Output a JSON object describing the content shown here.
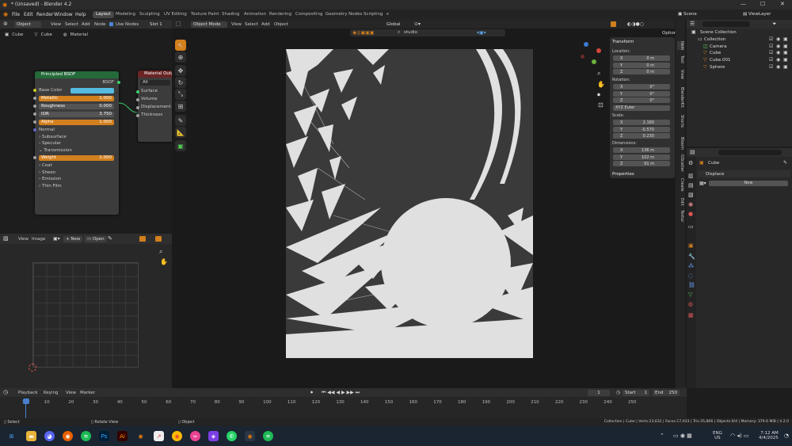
{
  "window": {
    "title": "* (Unsaved) - Blender 4.2"
  },
  "menus": [
    "File",
    "Edit",
    "Render",
    "Window",
    "Help"
  ],
  "workspaces": [
    "Layout",
    "Modeling",
    "Sculpting",
    "UV Editing",
    "Texture Paint",
    "Shading",
    "Animation",
    "Rendering",
    "Compositing",
    "Geometry Nodes",
    "Scripting",
    "+"
  ],
  "scene": {
    "label": "Scene",
    "view_layer": "ViewLayer"
  },
  "node_editor": {
    "object_mode": "Object",
    "menus": [
      "View",
      "Select",
      "Add",
      "Node"
    ],
    "use_nodes": "Use Nodes",
    "slot": "Slot 1",
    "breadcrumb": [
      "Cube",
      "Cube",
      "Material"
    ]
  },
  "bsdf": {
    "title": "Principled BSDF",
    "output": "BSDF",
    "rows": [
      {
        "label": "Base Color",
        "type": "color"
      },
      {
        "label": "Metallic",
        "value": "1.000",
        "type": "orange"
      },
      {
        "label": "Roughness",
        "value": "0.000",
        "type": "gray"
      },
      {
        "label": "IOR",
        "value": "3.750",
        "type": "gray"
      },
      {
        "label": "Alpha",
        "value": "1.000",
        "type": "orange"
      },
      {
        "label": "Normal",
        "type": "plain"
      },
      {
        "label": "Subsurface",
        "type": "sub"
      },
      {
        "label": "Specular",
        "type": "sub"
      },
      {
        "label": "Transmission",
        "type": "open"
      },
      {
        "label": "Weight",
        "value": "1.000",
        "type": "orange"
      },
      {
        "label": "Coat",
        "type": "sub"
      },
      {
        "label": "Sheen",
        "type": "sub"
      },
      {
        "label": "Emission",
        "type": "sub"
      },
      {
        "label": "Thin Film",
        "type": "sub"
      }
    ]
  },
  "mat_output": {
    "title": "Material Output",
    "target": "All",
    "inputs": [
      "Surface",
      "Volume",
      "Displacement",
      "Thickness"
    ]
  },
  "image_editor": {
    "menus": [
      "View",
      "Image"
    ],
    "new": "New",
    "open": "Open"
  },
  "viewport": {
    "mode": "Object Mode",
    "menus": [
      "View",
      "Select",
      "Add",
      "Object"
    ],
    "orientation": "Global",
    "hdri": "studio",
    "options": "Options"
  },
  "transform": {
    "title": "Transform",
    "location_label": "Location:",
    "location": [
      {
        "axis": "X",
        "value": "0 m"
      },
      {
        "axis": "Y",
        "value": "0 m"
      },
      {
        "axis": "Z",
        "value": "0 m"
      }
    ],
    "rotation_label": "Rotation:",
    "rotation": [
      {
        "axis": "X",
        "value": "0°"
      },
      {
        "axis": "Y",
        "value": "0°"
      },
      {
        "axis": "Z",
        "value": "0°"
      }
    ],
    "euler": "XYZ Euler",
    "scale_label": "Scale:",
    "scale": [
      {
        "axis": "X",
        "value": "2.160"
      },
      {
        "axis": "Y",
        "value": "-0.570"
      },
      {
        "axis": "Z",
        "value": "0.230"
      }
    ],
    "dims_label": "Dimensions:",
    "dims": [
      {
        "axis": "X",
        "value": "136 m"
      },
      {
        "axis": "Y",
        "value": "102 m"
      },
      {
        "axis": "Z",
        "value": "91 m"
      }
    ],
    "properties": "Properties"
  },
  "side_tabs": [
    "Item",
    "Tool",
    "View",
    "BlenderKit",
    "Shorts",
    "Bloom",
    "GScatter",
    "Create",
    "Edit",
    "Textur"
  ],
  "outliner": {
    "title": "Scene Collection",
    "items": [
      {
        "name": "Collection",
        "indent": 0
      },
      {
        "name": "Camera",
        "indent": 1
      },
      {
        "name": "Cube",
        "indent": 1
      },
      {
        "name": "Cube.001",
        "indent": 1
      },
      {
        "name": "Sphere",
        "indent": 1
      }
    ]
  },
  "properties": {
    "object": "Cube",
    "modifier": "Displace",
    "new": "New"
  },
  "timeline": {
    "menus": [
      "Playback",
      "Keying",
      "View",
      "Marker"
    ],
    "frame": "1",
    "start_label": "Start",
    "start": "1",
    "end_label": "End",
    "end": "250",
    "ticks": [
      "1",
      "10",
      "20",
      "30",
      "40",
      "50",
      "60",
      "70",
      "80",
      "90",
      "100",
      "110",
      "120",
      "130",
      "140",
      "150",
      "160",
      "170",
      "180",
      "190",
      "200",
      "210",
      "220",
      "230",
      "240",
      "250"
    ]
  },
  "statusbar": {
    "select": "Select",
    "rotate": "Rotate View",
    "object": "Object",
    "stats": "Collection | Cube | Verts:23,632 | Faces:17,933 | Tris:35,866 | Objects:0/4 | Memory: 379.6 MiB | 4.2.0"
  },
  "taskbar": {
    "lang": "ENG",
    "region": "US",
    "time": "7:12 AM",
    "date": "4/4/2025"
  },
  "colors": {
    "accent": "#d27f1e",
    "node_green": "#246a3a",
    "node_red": "#6a2424",
    "base_color": "#55bbe0"
  }
}
